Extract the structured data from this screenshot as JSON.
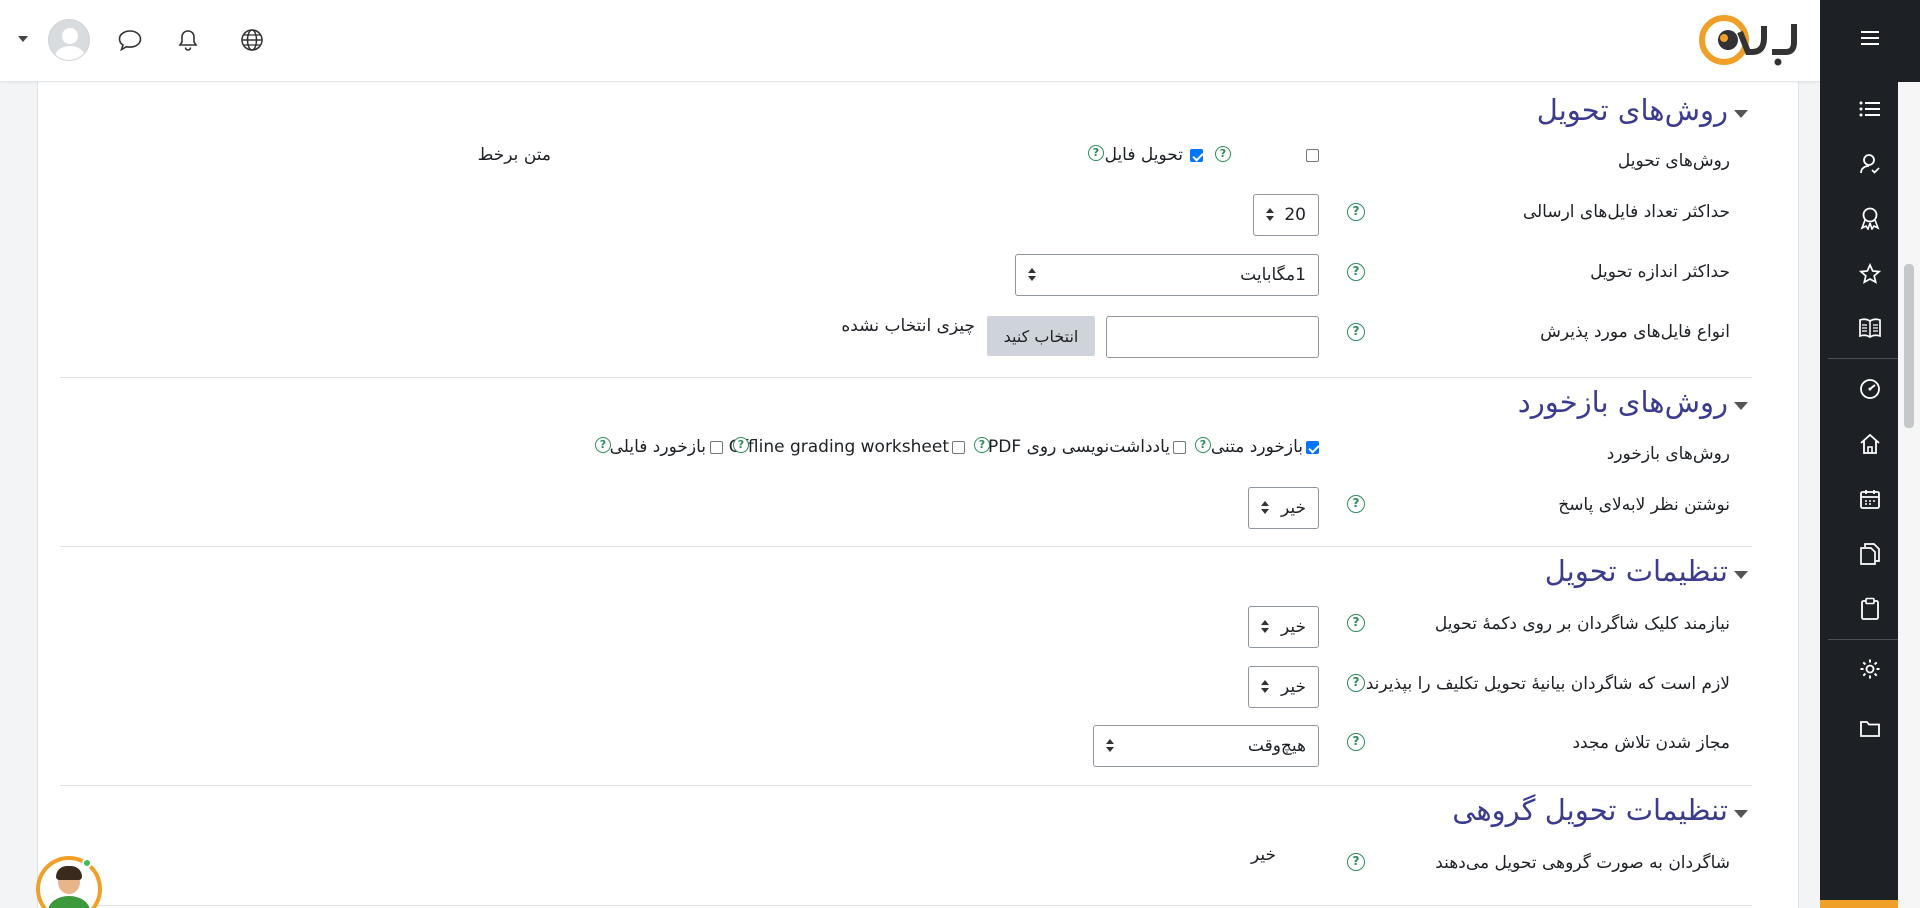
{
  "navbar": {
    "logo_text": "وب",
    "icons": [
      "menu-icon",
      "globe-icon",
      "bell-icon",
      "chat-icon",
      "avatar",
      "dropdown-caret"
    ]
  },
  "sidebar": {
    "items": [
      "list-icon",
      "user-check-icon",
      "badge-icon",
      "star-icon",
      "book-icon",
      "dashboard-icon",
      "home-icon",
      "calendar-icon",
      "files-icon",
      "clipboard-icon",
      "settings-icon",
      "folder-icon"
    ]
  },
  "sections": {
    "submission_types": {
      "title": "روش‌های تحویل",
      "types_label": "روش‌های تحویل",
      "opt_online_text": "متن برخط",
      "opt_file": "تحویل فایل",
      "max_files_label": "حداکثر تعداد فایل‌های ارسالی",
      "max_files_value": "20",
      "max_size_label": "حداکثر اندازه تحویل",
      "max_size_value": "1مگابایت",
      "accepted_types_label": "انواع فایل‌های مورد پذیرش",
      "choose_button": "انتخاب کنید",
      "nothing_selected": "چیزی انتخاب نشده"
    },
    "feedback_types": {
      "title": "روش‌های بازخورد",
      "types_label": "روش‌های بازخورد",
      "opt_comments": "بازخورد متنی",
      "opt_pdf": "یادداشت‌نویسی روی PDF",
      "opt_offline": "Offline grading worksheet",
      "opt_files": "بازخورد فایلی",
      "inline_label": "نوشتن نظر لابه‌لای پاسخ",
      "inline_value": "خیر"
    },
    "submission_settings": {
      "title": "تنظیمات تحویل",
      "click_submit_label": "نیازمند کلیک شاگردان بر روی دکمهٔ تحویل",
      "click_submit_value": "خیر",
      "statement_label": "لازم است که شاگردان بیانیهٔ تحویل تکلیف را بپذیرند",
      "statement_value": "خیر",
      "reopen_label": "مجاز شدن تلاش مجدد",
      "reopen_value": "هیچ‌وقت"
    },
    "group_settings": {
      "title": "تنظیمات تحویل گروهی",
      "team_label": "شاگردان به صورت گروهی تحویل می‌دهند",
      "team_value": "خیر"
    }
  },
  "help_glyph": "?",
  "colors": {
    "sidebar_bg": "#1d2125",
    "section_title": "#3b3b8f",
    "help_icon": "#2c8c5b",
    "checkbox_checked": "#0075ff",
    "accent": "#f0a028"
  }
}
